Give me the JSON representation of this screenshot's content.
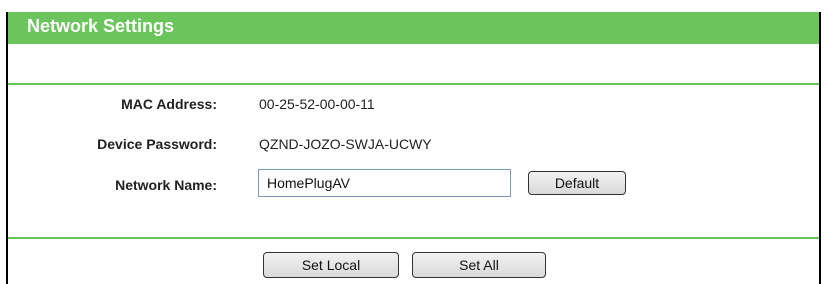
{
  "header": {
    "title": "Network Settings"
  },
  "fields": {
    "mac_label": "MAC Address:",
    "mac_value": "00-25-52-00-00-11",
    "password_label": "Device Password:",
    "password_value": "QZND-JOZO-SWJA-UCWY",
    "network_name_label": "Network Name:",
    "network_name_value": "HomePlugAV"
  },
  "buttons": {
    "default_label": "Default",
    "set_local_label": "Set Local",
    "set_all_label": "Set All"
  },
  "colors": {
    "accent": "#6bc55c"
  }
}
